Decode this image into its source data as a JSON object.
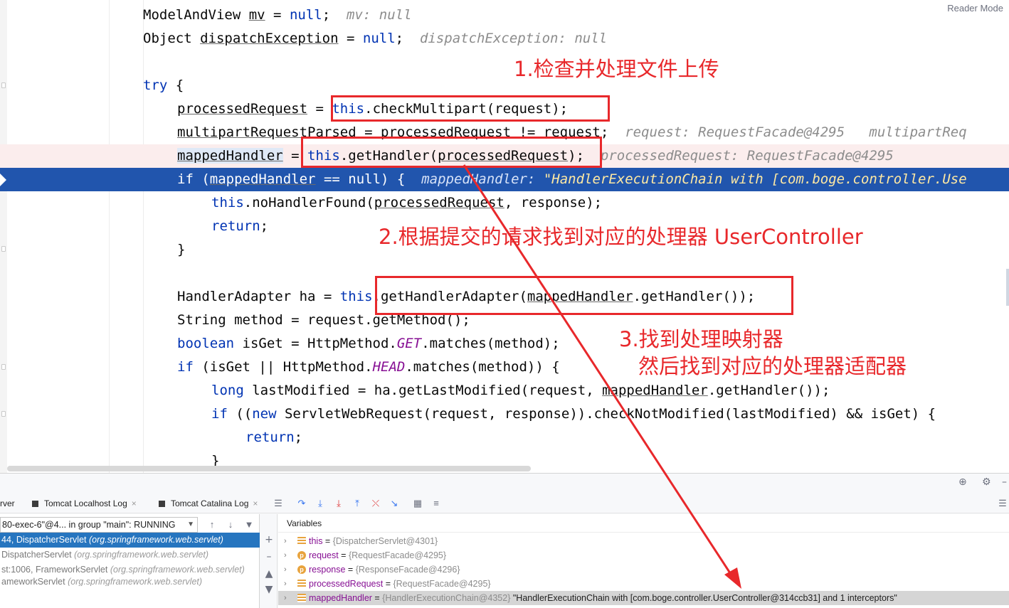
{
  "editor": {
    "reader_mode": "Reader Mode",
    "lines": {
      "l1": {
        "pre": "ModelAndView ",
        "var": "mv",
        "eq": " = ",
        "nul": "null",
        "end": ";",
        "hint": "mv: null"
      },
      "l2": {
        "pre": "Object ",
        "var": "dispatchException",
        "eq": " = ",
        "nul": "null",
        "end": ";",
        "hint": "dispatchException: null"
      },
      "l3": {
        "kw": "try",
        "rest": " {"
      },
      "l4": {
        "var": "processedRequest",
        "eq": " = ",
        "this": "this",
        "call": ".checkMultipart(request);"
      },
      "l5": {
        "var": "multipartRequestParsed",
        "mid": " = ",
        "var2": "processedRequest",
        "rest": " != request;",
        "hint1": "request: RequestFacade@4295",
        "hint2": "multipartReq"
      },
      "l6": {
        "var": "mappedHandler",
        "eq": " = ",
        "this": "this",
        "call": ".getHandler(",
        "arg": "processedRequest",
        "end": ");",
        "hint": "processedRequest: RequestFacade@4295"
      },
      "l7": {
        "kw": "if",
        "open": " (",
        "var": "mappedHandler",
        "rest": " == null) {",
        "hint_name": "mappedHandler:",
        "hint_val": "\"HandlerExecutionChain with [com.boge.controller.Use"
      },
      "l8": {
        "this": "this",
        "call": ".noHandlerFound(",
        "arg": "processedRequest",
        "rest": ", response);"
      },
      "l9": {
        "kw": "return",
        "rest": ";"
      },
      "l10": {
        "text": "}"
      },
      "l11": {
        "pre": "HandlerAdapter ha = ",
        "this": "this",
        "call": ".getHandlerAdapter(",
        "arg": "mappedHandler",
        "rest": ".getHandler());"
      },
      "l12": {
        "text": "String method = request.getMethod();"
      },
      "l13": {
        "kw": "boolean",
        "mid": " isGet = HttpMethod.",
        "st": "GET",
        "rest": ".matches(method);"
      },
      "l14": {
        "kw": "if",
        "mid": " (isGet || HttpMethod.",
        "st": "HEAD",
        "rest": ".matches(method)) {"
      },
      "l15": {
        "kw": "long",
        "mid": " lastModified = ha.getLastModified(request, ",
        "arg": "mappedHandler",
        "rest": ".getHandler());"
      },
      "l16": {
        "kw": "if",
        "mid": " ((",
        "kw2": "new",
        "rest": " ServletWebRequest(request, response)).checkNotModified(lastModified) && isGet) {"
      },
      "l17": {
        "kw": "return",
        "rest": ";"
      },
      "l18": {
        "text": "}"
      }
    }
  },
  "annotations": {
    "a1": "1.检查并处理文件上传",
    "a2": "2.根据提交的请求找到对应的处理器 UserController",
    "a3_line1": "3.找到处理映射器",
    "a3_line2": "然后找到对应的处理器适配器",
    "color": "#e8282b"
  },
  "debug": {
    "tabs": {
      "server": "rver",
      "localhost": "Tomcat Localhost Log",
      "catalina": "Tomcat Catalina Log"
    },
    "thread": "80-exec-6\"@4... in group \"main\": RUNNING",
    "frames": [
      {
        "loc": "44, DispatcherServlet ",
        "pkg": "(org.springframework.web.servlet)"
      },
      {
        "loc": "DispatcherServlet ",
        "pkg": "(org.springframework.web.servlet)"
      },
      {
        "loc": "st:1006, FrameworkServlet ",
        "pkg": "(org.springframework.web.servlet)"
      },
      {
        "loc": "ameworkServlet ",
        "pkg": "(org.springframework.web.servlet)"
      }
    ],
    "variables_title": "Variables",
    "variables": [
      {
        "icon": "field",
        "name": "this",
        "eq": " = ",
        "type": "{DispatcherServlet@4301}",
        "value": ""
      },
      {
        "icon": "param",
        "name": "request",
        "eq": " = ",
        "type": "{RequestFacade@4295}",
        "value": ""
      },
      {
        "icon": "param",
        "name": "response",
        "eq": " = ",
        "type": "{ResponseFacade@4296}",
        "value": ""
      },
      {
        "icon": "field",
        "name": "processedRequest",
        "eq": " = ",
        "type": "{RequestFacade@4295}",
        "value": ""
      },
      {
        "icon": "field",
        "name": "mappedHandler",
        "eq": " = ",
        "type": "{HandlerExecutionChain@4352}",
        "value": " \"HandlerExecutionChain with [com.boge.controller.UserController@314ccb31] and 1 interceptors\""
      }
    ]
  }
}
